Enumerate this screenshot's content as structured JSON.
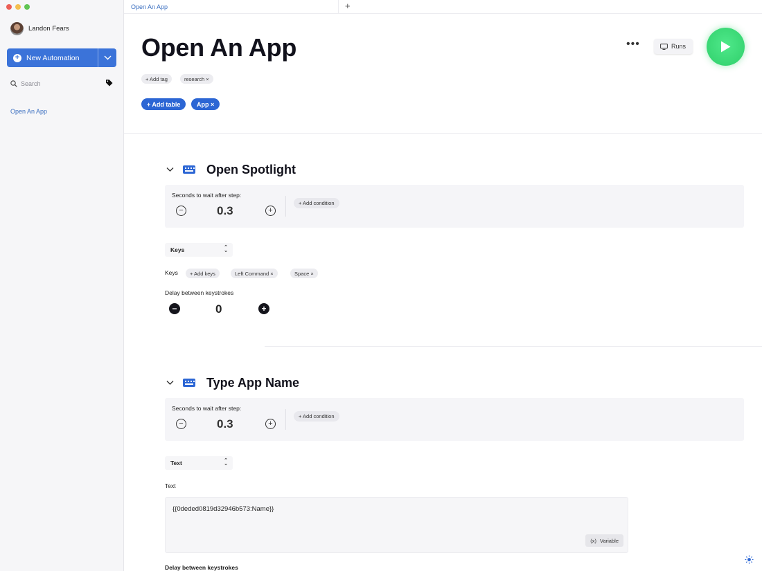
{
  "window": {
    "traffic_colors": [
      "#ec5f57",
      "#f4bf4f",
      "#61c554"
    ]
  },
  "sidebar": {
    "user_name": "Landon Fears",
    "new_automation_label": "New Automation",
    "search_placeholder": "Search",
    "items": [
      {
        "label": "Open An App"
      }
    ]
  },
  "tabs": [
    {
      "label": "Open An App"
    }
  ],
  "header": {
    "title": "Open An App",
    "more_label": "•••",
    "runs_label": "Runs",
    "add_tag_label": "+ Add tag",
    "tags": [
      "research ×"
    ],
    "add_table_label": "+ Add table",
    "tables": [
      "App ×"
    ]
  },
  "steps": [
    {
      "title": "Open Spotlight",
      "wait_label": "Seconds to wait after step:",
      "wait_value": "0.3",
      "add_condition_label": "+ Add condition",
      "action_type": "Keys",
      "keys_label": "Keys",
      "add_keys_label": "+ Add keys",
      "keys": [
        "Left Command ×",
        "Space ×"
      ],
      "delay_label": "Delay between keystrokes",
      "delay_value": "0"
    },
    {
      "title": "Type App Name",
      "wait_label": "Seconds to wait after step:",
      "wait_value": "0.3",
      "add_condition_label": "+ Add condition",
      "action_type": "Text",
      "text_label": "Text",
      "text_value": "{{0deded0819d32946b573:Name}}",
      "variable_icon": "(x)",
      "variable_label": "Variable",
      "delay_label": "Delay between keystrokes"
    }
  ],
  "colors": {
    "accent": "#2c66d4",
    "run": "#35d46e"
  }
}
